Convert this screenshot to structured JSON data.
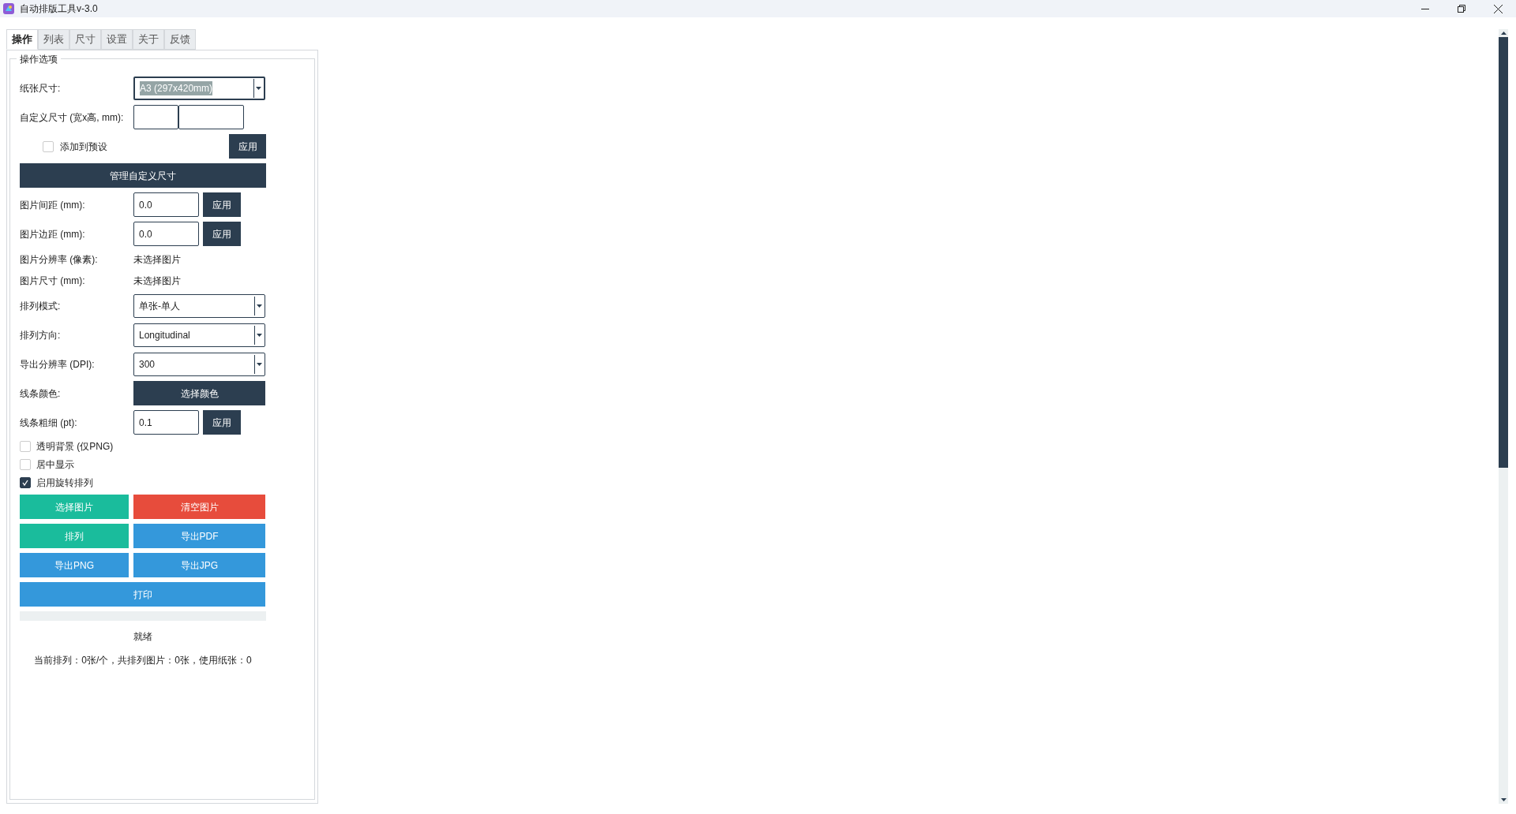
{
  "window": {
    "title": "自动排版工具v-3.0"
  },
  "tabs": [
    {
      "label": "操作",
      "selected": true
    },
    {
      "label": "列表",
      "selected": false
    },
    {
      "label": "尺寸",
      "selected": false
    },
    {
      "label": "设置",
      "selected": false
    },
    {
      "label": "关于",
      "selected": false
    },
    {
      "label": "反馈",
      "selected": false
    }
  ],
  "group": {
    "title": "操作选项"
  },
  "rows": [
    {
      "kind": "select",
      "label": "纸张尺寸:",
      "value": "A3 (297x420mm)",
      "focused": true
    },
    {
      "kind": "dual_input",
      "label": "自定义尺寸 (宽x高, mm):"
    },
    {
      "kind": "preset",
      "label": "添加到预设",
      "checked": false,
      "button": "应用"
    },
    {
      "kind": "wide_button",
      "button": "管理自定义尺寸"
    },
    {
      "kind": "input_apply",
      "label": "图片间距 (mm):",
      "value": "0.0",
      "button": "应用"
    },
    {
      "kind": "input_apply",
      "label": "图片边距 (mm):",
      "value": "0.0",
      "button": "应用"
    },
    {
      "kind": "info",
      "label": "图片分辨率 (像素):",
      "value": "未选择图片"
    },
    {
      "kind": "info",
      "label": "图片尺寸 (mm):",
      "value": "未选择图片"
    },
    {
      "kind": "select",
      "label": "排列模式:",
      "value": "单张-单人",
      "focused": false
    },
    {
      "kind": "select",
      "label": "排列方向:",
      "value": "Longitudinal",
      "focused": false
    },
    {
      "kind": "select",
      "label": "导出分辨率 (DPI):",
      "value": "300",
      "focused": false
    },
    {
      "kind": "button",
      "label": "线条颜色:",
      "button": "选择颜色"
    },
    {
      "kind": "input_apply",
      "label": "线条粗细 (pt):",
      "value": "0.1",
      "button": "应用"
    }
  ],
  "checkboxes": [
    {
      "label": "透明背景 (仅PNG)",
      "checked": false
    },
    {
      "label": "居中显示",
      "checked": false
    },
    {
      "label": "启用旋转排列",
      "checked": true
    }
  ],
  "actions": [
    {
      "label": "选择图片",
      "color": "#1abc9c",
      "wide": false
    },
    {
      "label": "清空图片",
      "color": "#e74c3c",
      "wide": false
    },
    {
      "label": "排列",
      "color": "#1abc9c",
      "wide": false
    },
    {
      "label": "导出PDF",
      "color": "#3498db",
      "wide": false
    },
    {
      "label": "导出PNG",
      "color": "#3498db",
      "wide": false
    },
    {
      "label": "导出JPG",
      "color": "#3498db",
      "wide": false
    },
    {
      "label": "打印",
      "color": "#3498db",
      "wide": true
    }
  ],
  "progress": {
    "level": 0
  },
  "status": "就绪",
  "summary": "当前排列：0张/个，共排列图片：0张，使用纸张：0"
}
